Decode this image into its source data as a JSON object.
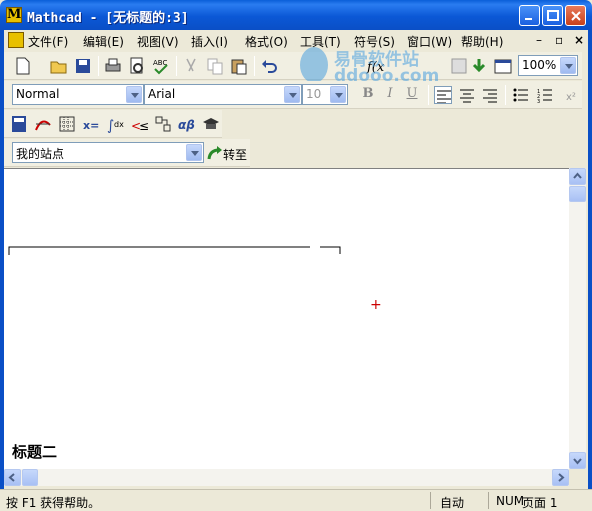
{
  "window": {
    "title": "Mathcad - [无标题的:3]"
  },
  "menu": {
    "items": [
      "文件(F)",
      "编辑(E)",
      "视图(V)",
      "插入(I)",
      "格式(O)",
      "工具(T)",
      "符号(S)",
      "窗口(W)",
      "帮助(H)"
    ]
  },
  "standard_toolbar": {
    "zoom": "100%"
  },
  "format_toolbar": {
    "style": "Normal",
    "font": "Arial",
    "size": "10"
  },
  "resources_toolbar": {
    "site": "我的站点",
    "goto_label": "转至"
  },
  "math_toolbar": {
    "icons": [
      "calculator-icon",
      "graph-icon",
      "matrix-icon",
      "evaluation-icon",
      "calculus-icon",
      "boolean-icon",
      "programming-icon",
      "greek-icon",
      "symbolic-icon"
    ]
  },
  "document": {
    "heading": "标题二",
    "cursor_mark": "+"
  },
  "watermark": {
    "text": "易骨软件站",
    "url": "ddooo.com"
  },
  "status": {
    "help": "按 F1 获得帮助。",
    "calc_mode": "自动",
    "num": "NUM",
    "page": "页面 1"
  }
}
